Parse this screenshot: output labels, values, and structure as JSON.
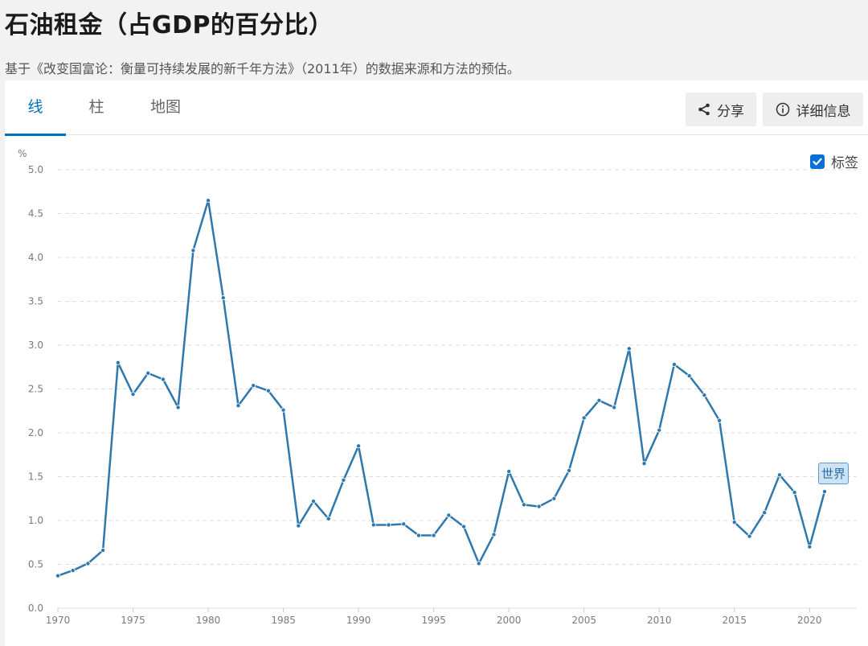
{
  "page": {
    "title": "石油租金（占GDP的百分比）",
    "subtitle": "基于《改变国富论：衡量可持续发展的新千年方法》（2011年）的数据来源和方法的预估。"
  },
  "tabs": [
    {
      "label": "线",
      "active": true
    },
    {
      "label": "柱",
      "active": false
    },
    {
      "label": "地图",
      "active": false
    }
  ],
  "toolbar": {
    "share_label": "分享",
    "details_label": "详细信息",
    "labels_toggle": "标签",
    "labels_checked": true
  },
  "colors": {
    "accent": "#0071bc",
    "series": "#2e78ad"
  },
  "chart_data": {
    "type": "line",
    "ylabel": "%",
    "xlim": [
      1970,
      2021
    ],
    "ylim": [
      0,
      5
    ],
    "yticks": [
      "0.0",
      "0.5",
      "1.0",
      "1.5",
      "2.0",
      "2.5",
      "3.0",
      "3.5",
      "4.0",
      "4.5",
      "5.0"
    ],
    "xticks": [
      "1970",
      "1975",
      "1980",
      "1985",
      "1990",
      "1995",
      "2000",
      "2005",
      "2010",
      "2015",
      "2020"
    ],
    "grid": true,
    "x": [
      1970,
      1971,
      1972,
      1973,
      1974,
      1975,
      1976,
      1977,
      1978,
      1979,
      1980,
      1981,
      1982,
      1983,
      1984,
      1985,
      1986,
      1987,
      1988,
      1989,
      1990,
      1991,
      1992,
      1993,
      1994,
      1995,
      1996,
      1997,
      1998,
      1999,
      2000,
      2001,
      2002,
      2003,
      2004,
      2005,
      2006,
      2007,
      2008,
      2009,
      2010,
      2011,
      2012,
      2013,
      2014,
      2015,
      2016,
      2017,
      2018,
      2019,
      2020,
      2021
    ],
    "series": [
      {
        "name": "世界",
        "values": [
          0.37,
          0.43,
          0.51,
          0.66,
          2.8,
          2.44,
          2.68,
          2.61,
          2.29,
          4.08,
          4.65,
          3.54,
          2.31,
          2.54,
          2.48,
          2.26,
          0.94,
          1.22,
          1.02,
          1.46,
          1.85,
          0.95,
          0.95,
          0.96,
          0.83,
          0.83,
          1.06,
          0.93,
          0.51,
          0.84,
          1.56,
          1.18,
          1.16,
          1.25,
          1.57,
          2.17,
          2.37,
          2.29,
          2.96,
          1.65,
          2.03,
          2.78,
          2.65,
          2.43,
          2.14,
          0.98,
          0.82,
          1.09,
          1.52,
          1.32,
          0.7,
          1.33
        ]
      }
    ]
  }
}
